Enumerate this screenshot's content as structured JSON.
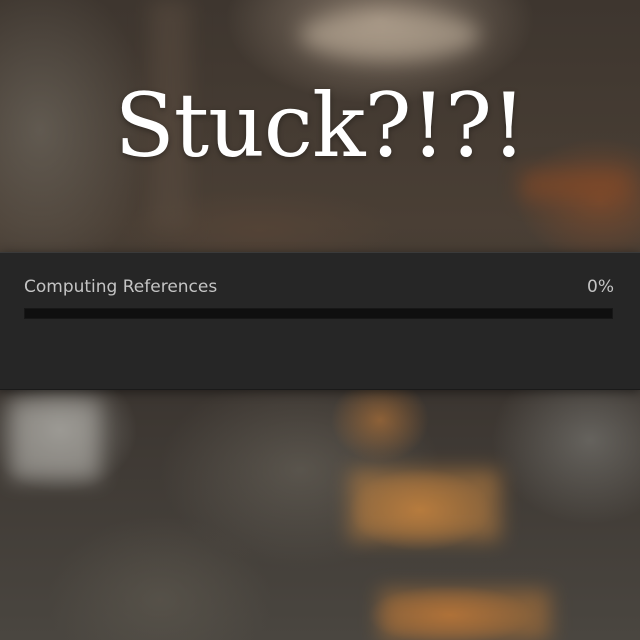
{
  "caption": {
    "text": "Stuck?!?!"
  },
  "progress_dialog": {
    "task_label": "Computing References",
    "percent_label": "0%",
    "progress_fraction": 0
  },
  "colors": {
    "dialog_background": "#262626",
    "track": "#0f0f0f",
    "label_text": "#c4c4c4",
    "caption_text": "#ffffff"
  }
}
